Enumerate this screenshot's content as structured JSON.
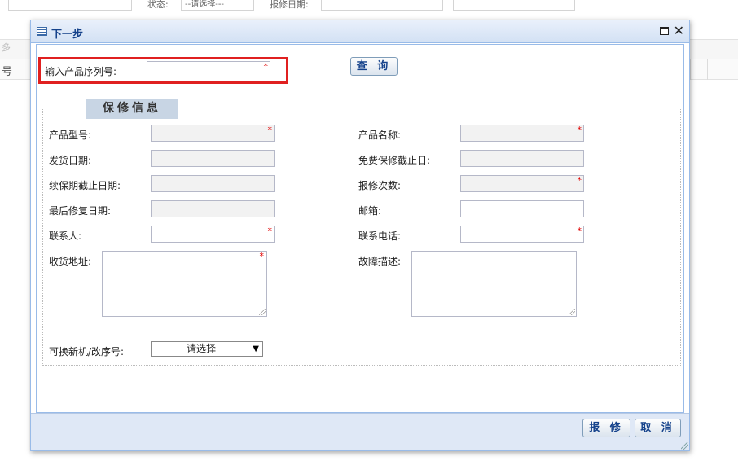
{
  "background": {
    "filter_labels": [
      "状态:",
      "--请选择---",
      "报修日期:"
    ],
    "left_fragments": [
      "多",
      "号"
    ]
  },
  "dialog": {
    "title": "下一步",
    "serial_label": "输入产品序列号:",
    "serial_value": "",
    "query_button": "查 询",
    "section_title": "保修信息",
    "fields": {
      "product_model": {
        "label": "产品型号:",
        "value": "",
        "required": "*"
      },
      "product_name": {
        "label": "产品名称:",
        "value": "",
        "required": "*"
      },
      "ship_date": {
        "label": "发货日期:",
        "value": ""
      },
      "free_warranty_end": {
        "label": "免费保修截止日:",
        "value": ""
      },
      "extended_warranty_end": {
        "label": "续保期截止日期:",
        "value": ""
      },
      "repair_count": {
        "label": "报修次数:",
        "value": "",
        "required": "*"
      },
      "last_repair_date": {
        "label": "最后修复日期:",
        "value": ""
      },
      "email": {
        "label": "邮箱:",
        "value": ""
      },
      "contact": {
        "label": "联系人:",
        "value": "",
        "required": "*"
      },
      "contact_phone": {
        "label": "联系电话:",
        "value": "",
        "required": "*"
      },
      "shipping_address": {
        "label": "收货地址:",
        "value": "",
        "required": "*"
      },
      "fault_description": {
        "label": "故障描述:",
        "value": ""
      },
      "replacement_serial": {
        "label": "可换新机/改序号:",
        "selected": "---------请选择---------"
      }
    },
    "required_mark": "*",
    "buttons": {
      "report": "报 修",
      "cancel": "取 消"
    }
  }
}
